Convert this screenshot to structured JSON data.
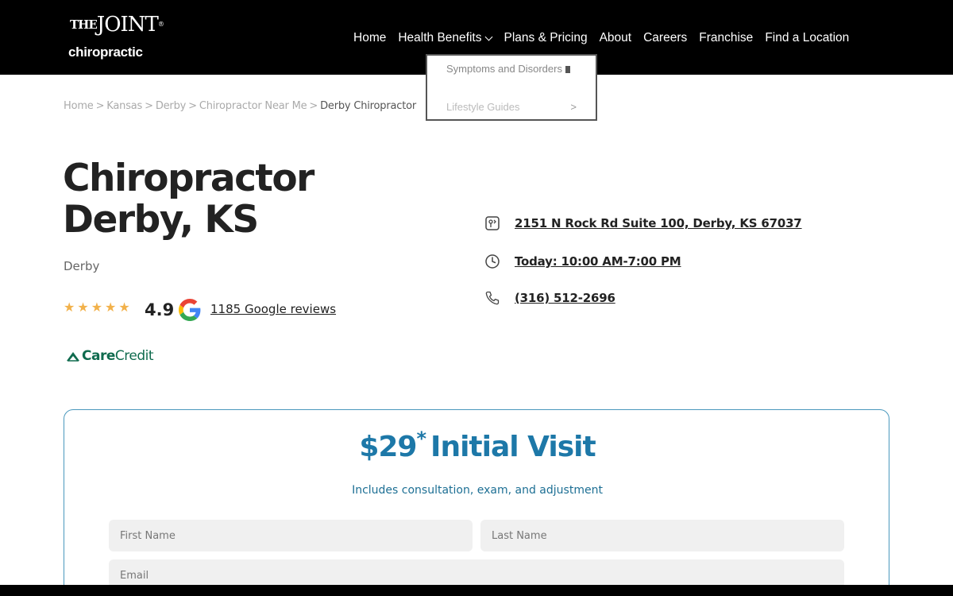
{
  "header": {
    "logo": {
      "the": "THE",
      "joint": "JOINT",
      "reg": "®",
      "chiropractic": "chiropractic"
    },
    "nav": [
      {
        "label": "Home"
      },
      {
        "label": "Health Benefits",
        "has_dropdown": true
      },
      {
        "label": "Plans & Pricing"
      },
      {
        "label": "About"
      },
      {
        "label": "Careers"
      },
      {
        "label": "Franchise"
      },
      {
        "label": "Find a Location"
      }
    ],
    "dropdown": {
      "items": [
        {
          "label": "Symptoms and Disorders"
        },
        {
          "label": "Lifestyle Guides",
          "arrow": ">"
        }
      ]
    }
  },
  "breadcrumb": {
    "items": [
      "Home",
      "Kansas",
      "Derby",
      "Chiropractor Near Me"
    ],
    "separator": ">",
    "current": "Derby Chiropractor"
  },
  "page": {
    "title_line1": "Chiropractor",
    "title_line2": "Derby, KS",
    "subtitle": "Derby"
  },
  "rating": {
    "stars": 5,
    "value": "4.9",
    "reviews_label": "1185 Google reviews"
  },
  "carecredit": {
    "care": "Care",
    "credit": "Credit"
  },
  "location": {
    "address": "2151 N Rock Rd Suite 100, Derby, KS 67037",
    "hours": "Today: 10:00 AM-7:00 PM",
    "phone": "(316) 512-2696"
  },
  "offer": {
    "price": "$29",
    "asterisk": "*",
    "label": "Initial Visit",
    "subtitle": "Includes consultation, exam, and adjustment",
    "form": {
      "first_name_placeholder": "First Name",
      "last_name_placeholder": "Last Name",
      "email_placeholder": "Email"
    }
  },
  "colors": {
    "header_bg": "#000000",
    "accent_blue": "#1d78a8",
    "star_gold": "#f2b14a",
    "carecredit_green": "#0f6b4e"
  }
}
